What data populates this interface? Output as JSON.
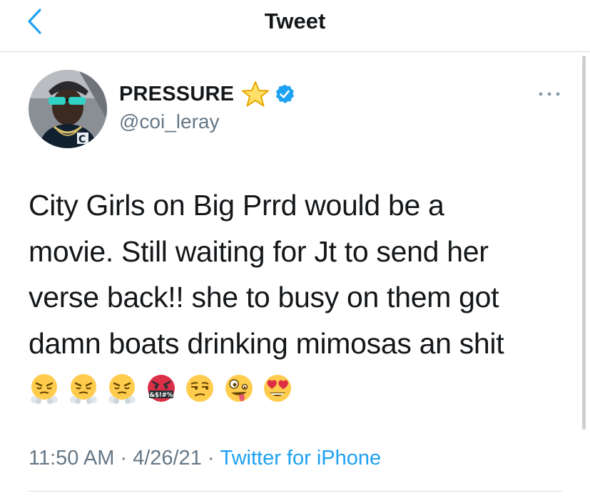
{
  "nav": {
    "title": "Tweet",
    "back_icon": "chevron-left-icon"
  },
  "colors": {
    "accent": "#1da1f2",
    "secondary_text": "#657786",
    "primary_text": "#14171a",
    "divider": "#d9dde0"
  },
  "tweet": {
    "author": {
      "display_name": "PRESSURE",
      "handle": "@coi_leray",
      "badges": [
        "star-emoji-icon",
        "verified-badge-icon"
      ]
    },
    "more_icon": "more-horizontal-icon",
    "text": "City Girls on Big Prrd would be a\nmovie. Still waiting for Jt to send her\nverse back!! she to busy on them got\ndamn boats drinking mimosas an shit",
    "emojis": [
      "steam-nose-face",
      "steam-nose-face",
      "steam-nose-face",
      "cursing-face",
      "unamused-face",
      "zany-face",
      "heart-eyes-face"
    ],
    "time": "11:50 AM",
    "separator": "·",
    "date": "4/26/21",
    "source": "Twitter for iPhone"
  }
}
